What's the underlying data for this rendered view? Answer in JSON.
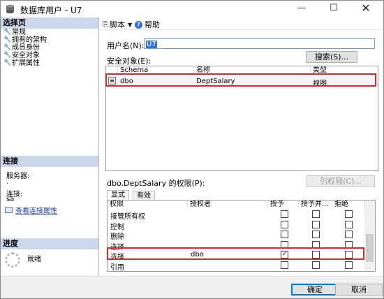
{
  "window": {
    "title": "数据库用户 - U7",
    "min_glyph": "—",
    "max_glyph": "☐",
    "close_glyph": "✕"
  },
  "left": {
    "select_page_header": "选择页",
    "pages": [
      {
        "label": "常规",
        "icon": "wrench-icon"
      },
      {
        "label": "拥有的架构",
        "icon": "wrench-icon"
      },
      {
        "label": "成员身份",
        "icon": "wrench-icon"
      },
      {
        "label": "安全对象",
        "icon": "wrench-icon"
      },
      {
        "label": "扩展属性",
        "icon": "wrench-icon"
      }
    ],
    "connection_header": "连接",
    "server_label": "服务器:",
    "server_value": ".",
    "connection_label": "连接:",
    "connection_value": "sa",
    "view_conn_props": "查看连接属性",
    "progress_header": "进度",
    "progress_status": "就绪"
  },
  "toolbar": {
    "script_label": "脚本",
    "help_label": "帮助"
  },
  "form": {
    "username_label": "用户名(N):",
    "username_value": "U7",
    "securables_label": "安全对象(E):",
    "search_button": "搜索(S)...",
    "securables_columns": [
      "Schema",
      "名称",
      "类型"
    ],
    "securables_rows": [
      {
        "schema": "dbo",
        "name": "DeptSalary",
        "type": "视图"
      }
    ],
    "permissions_for_label": "dbo.DeptSalary 的权限(P):",
    "column_permissions_button": "列权限(C)...",
    "tabs": [
      "显式",
      "有效"
    ],
    "perm_columns": [
      "权限",
      "授权者",
      "授予",
      "授予并...",
      "拒绝"
    ],
    "perm_rows": [
      {
        "permission": "接管所有权",
        "grantor": "",
        "grant": false,
        "with_grant": false,
        "deny": false
      },
      {
        "permission": "控制",
        "grantor": "",
        "grant": false,
        "with_grant": false,
        "deny": false
      },
      {
        "permission": "删除",
        "grantor": "",
        "grant": false,
        "with_grant": false,
        "deny": false
      },
      {
        "permission": "选择",
        "grantor": "",
        "grant": false,
        "with_grant": false,
        "deny": false
      },
      {
        "permission": "选择",
        "grantor": "dbo",
        "grant": true,
        "with_grant": false,
        "deny": false
      },
      {
        "permission": "引用",
        "grantor": "",
        "grant": false,
        "with_grant": false,
        "deny": false
      }
    ]
  },
  "buttons": {
    "ok": "确定",
    "cancel": "取消"
  }
}
